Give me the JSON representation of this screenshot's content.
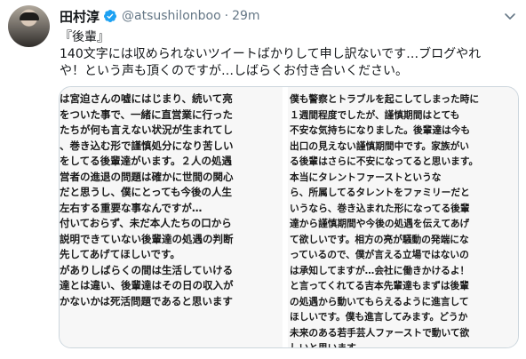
{
  "tweet": {
    "author_name": "田村淳",
    "handle": "@atsushilonboo",
    "separator": "·",
    "time": "29m",
    "text_lines": [
      "『後輩』",
      "140文字には収められないツイートばかりして申し訳ないです…ブログやれ",
      "や！という声も頂くのですが…しばらくお付き合いください。"
    ]
  },
  "icons": {
    "verified": "verified-badge-icon",
    "more": "chevron-down-icon"
  },
  "colors": {
    "verified": "#1da1f2",
    "muted": "#657786",
    "text": "#14171a"
  },
  "media": {
    "left_lines": [
      "は宮迫さんの嘘にはじまり、続いて亮",
      "をついた事で、一緒に直営業に行った",
      "たちが何も言えない状況が生まれてし",
      "、巻き込む形で謹慎処分になり苦しい",
      "をしてる後輩達がいます。２人の処遇",
      "営者の進退の問題は確かに世間の関心",
      "だと思うし、僕にとっても今後の人生",
      "左右する重要な事なんですが…",
      "付いておらず、未だ本人たちの口から",
      "説明できていない後輩達の処遇の判断",
      "先してあげてほしいです。",
      "がありしばらくの間は生活していける",
      "達とは違い、後輩達はその日の収入が",
      "かないかは死活問題であると思います"
    ],
    "right_lines": [
      "僕も警察とトラブルを起こしてしまった時に",
      "１週間程度でしたが、謹慎期間はとても",
      "不安な気持ちになりました。後輩達は今も",
      "出口の見えない謹慎期間中です。家族がい",
      "る後輩はさらに不安になってると思います。",
      "本当にタレントファーストというな",
      "ら、所属してるタレントをファミリーだと",
      "いうなら、巻き込まれた形になってる後輩",
      "達から謹慎期間や今後の処遇を伝えてあげ",
      "て欲しいです。相方の亮が騒動の発端にな",
      "っているので、僕が言える立場ではないの",
      "は承知してますが…会社に働きかけるよ！",
      "と言ってくれてる吉本先輩達もまずは後輩",
      "の処遇から動いてもらえるように進言して",
      "ほしいです。僕も進言してみます。どうか",
      "未来のある若手芸人ファーストで動いて欲",
      "しいと思います。"
    ]
  }
}
